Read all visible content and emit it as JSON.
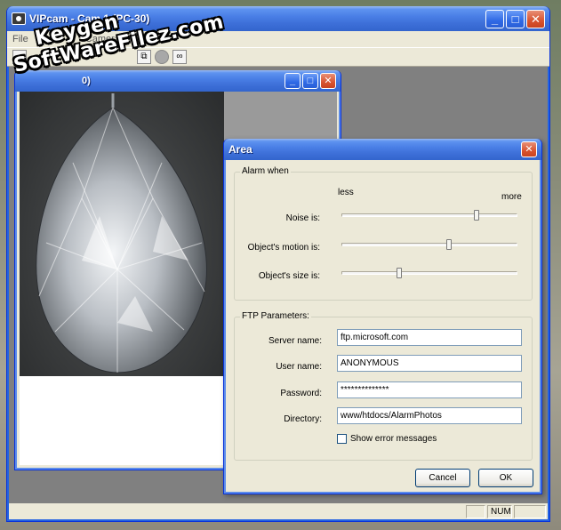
{
  "app": {
    "title": "VIPcam - Cam 1 (PC-30)",
    "menu": [
      "File",
      "View",
      "W",
      "Camera",
      "H"
    ],
    "status": {
      "num": "NUM"
    }
  },
  "child": {
    "title": "0)"
  },
  "dialog": {
    "title": "Area",
    "alarm_group": "Alarm when",
    "less_label": "less",
    "more_label": "more",
    "sliders": [
      {
        "label": "Noise is:",
        "value": 0.77
      },
      {
        "label": "Object's motion is:",
        "value": 0.61
      },
      {
        "label": "Object's size is:",
        "value": 0.33
      }
    ],
    "ftp_group": "FTP Parameters:",
    "fields": {
      "server": {
        "label": "Server name:",
        "value": "ftp.microsoft.com"
      },
      "user": {
        "label": "User name:",
        "value": "ANONYMOUS"
      },
      "password": {
        "label": "Password:",
        "value": "**************"
      },
      "directory": {
        "label": "Directory:",
        "value": "www/htdocs/AlarmPhotos"
      }
    },
    "show_errors": {
      "label": "Show error messages",
      "checked": false
    },
    "cancel_label": "Cancel",
    "ok_label": "OK"
  },
  "watermark": {
    "line1": "Keygen",
    "line2": "SoftWareFilez.com"
  }
}
